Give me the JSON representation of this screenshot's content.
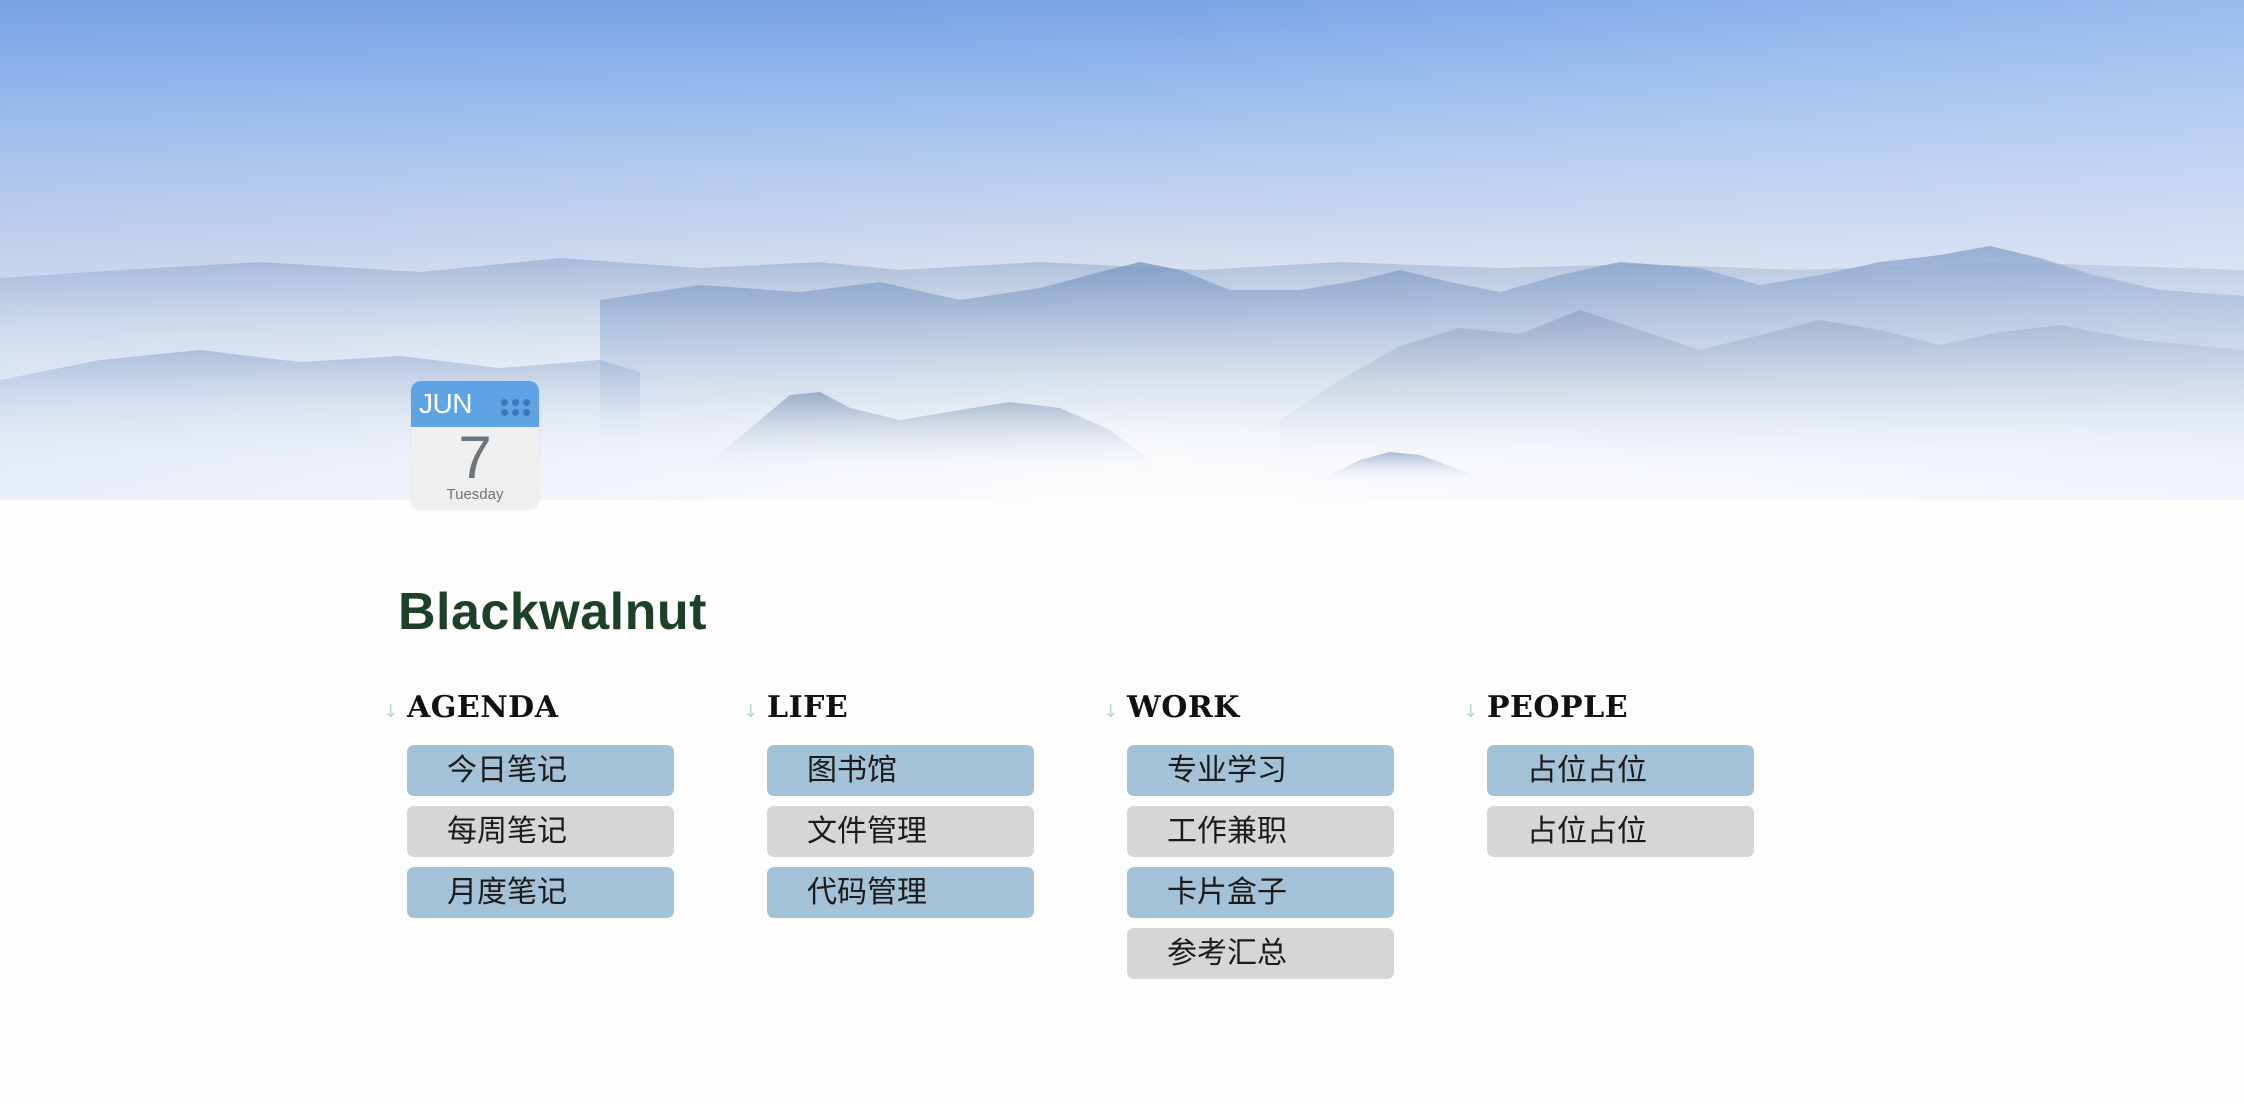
{
  "calendar": {
    "month": "JUN",
    "day": "7",
    "weekday": "Tuesday"
  },
  "title": "Blackwalnut",
  "colors": {
    "title": "#1d4126",
    "button_blue": "#a3c1d7",
    "button_gray": "#d6d6d7",
    "calendar_header": "#5ea3e3",
    "section_arrow": "#bcd6d0"
  },
  "sections": [
    {
      "id": "agenda",
      "title": "AGENDA",
      "icon": "arrow-down-icon",
      "items": [
        {
          "label": "今日笔记",
          "style": "blue"
        },
        {
          "label": "每周笔记",
          "style": "gray"
        },
        {
          "label": "月度笔记",
          "style": "blue"
        }
      ]
    },
    {
      "id": "life",
      "title": "LIFE",
      "icon": "arrow-down-icon",
      "items": [
        {
          "label": "图书馆",
          "style": "blue"
        },
        {
          "label": "文件管理",
          "style": "gray"
        },
        {
          "label": "代码管理",
          "style": "blue"
        }
      ]
    },
    {
      "id": "work",
      "title": "WORK",
      "icon": "arrow-down-icon",
      "items": [
        {
          "label": "专业学习",
          "style": "blue"
        },
        {
          "label": "工作兼职",
          "style": "gray"
        },
        {
          "label": "卡片盒子",
          "style": "blue"
        },
        {
          "label": "参考汇总",
          "style": "gray"
        }
      ]
    },
    {
      "id": "people",
      "title": "PEOPLE",
      "icon": "arrow-down-icon",
      "items": [
        {
          "label": "占位占位",
          "style": "blue"
        },
        {
          "label": "占位占位",
          "style": "gray"
        }
      ]
    }
  ]
}
